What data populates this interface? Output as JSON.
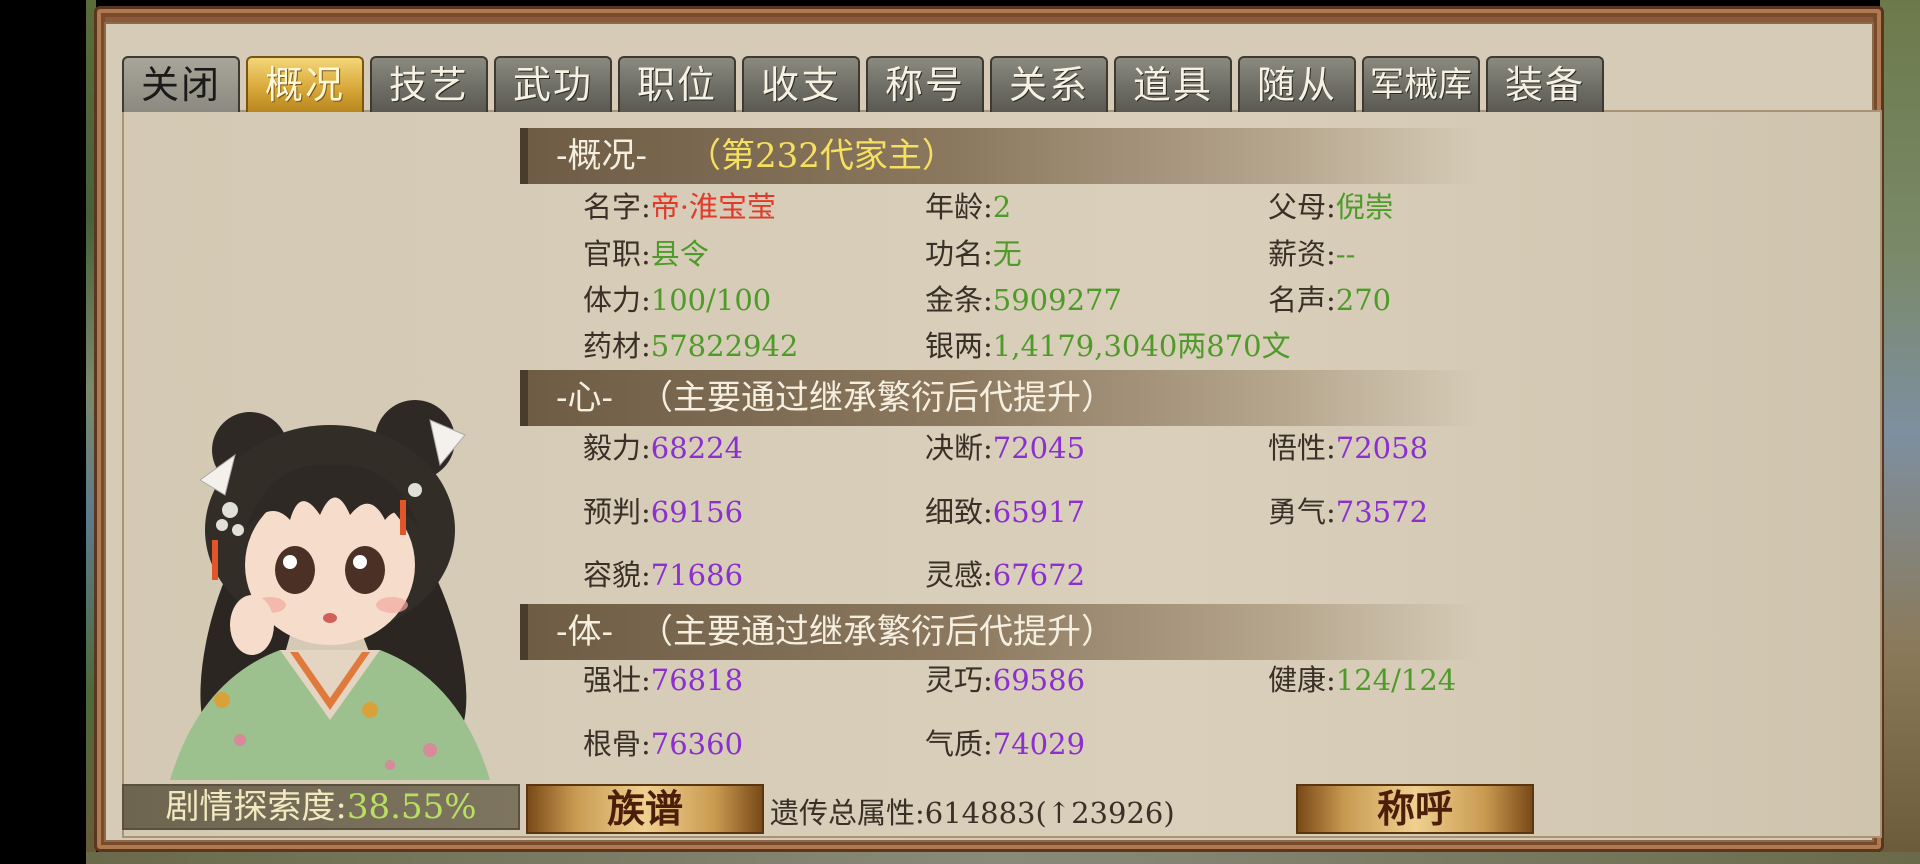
{
  "tabs": [
    {
      "label": "关闭"
    },
    {
      "label": "概况"
    },
    {
      "label": "技艺"
    },
    {
      "label": "武功"
    },
    {
      "label": "职位"
    },
    {
      "label": "收支"
    },
    {
      "label": "称号"
    },
    {
      "label": "关系"
    },
    {
      "label": "道具"
    },
    {
      "label": "随从"
    },
    {
      "label": "军械库"
    },
    {
      "label": "装备"
    }
  ],
  "active_tab": "概况",
  "overview": {
    "header": "-概况-",
    "generation": "（第232代家主）",
    "name_label": "名字:",
    "name_value": "帝·淮宝莹",
    "age_label": "年龄:",
    "age_value": "2",
    "parents_label": "父母:",
    "parents_value": "倪崇",
    "office_label": "官职:",
    "office_value": "县令",
    "merit_label": "功名:",
    "merit_value": "无",
    "salary_label": "薪资:",
    "salary_value": "--",
    "stamina_label": "体力:",
    "stamina_value": "100/100",
    "gold_label": "金条:",
    "gold_value": "5909277",
    "fame_label": "名声:",
    "fame_value": "270",
    "herbs_label": "药材:",
    "herbs_value": "57822942",
    "silver_label": "银两:",
    "silver_value": "1,4179,3040两870文"
  },
  "mind": {
    "header": "-心-",
    "note": "（主要通过继承繁衍后代提升）",
    "stats": [
      {
        "label": "毅力:",
        "value": "68224"
      },
      {
        "label": "决断:",
        "value": "72045"
      },
      {
        "label": "悟性:",
        "value": "72058"
      },
      {
        "label": "预判:",
        "value": "69156"
      },
      {
        "label": "细致:",
        "value": "65917"
      },
      {
        "label": "勇气:",
        "value": "73572"
      },
      {
        "label": "容貌:",
        "value": "71686"
      },
      {
        "label": "灵感:",
        "value": "67672"
      }
    ]
  },
  "body": {
    "header": "-体-",
    "note": "（主要通过继承繁衍后代提升）",
    "stats": [
      {
        "label": "强壮:",
        "value": "76818"
      },
      {
        "label": "灵巧:",
        "value": "69586"
      },
      {
        "label": "健康:",
        "value": "124/124"
      },
      {
        "label": "根骨:",
        "value": "76360"
      },
      {
        "label": "气质:",
        "value": "74029"
      }
    ]
  },
  "bottom": {
    "explore_label": "剧情探索度:",
    "explore_value": "38.55%",
    "genealogy_button": "族谱",
    "genetic_text": "遗传总属性:614883(",
    "genetic_arrow": "↑",
    "genetic_delta": "23926)",
    "title_button": "称呼"
  },
  "colors": {
    "active_tab": "#d9a93a",
    "value_green": "#4f9b2a",
    "value_purple": "#8b2fd0",
    "value_red": "#e03b2a",
    "header_highlight": "#f6e060"
  }
}
